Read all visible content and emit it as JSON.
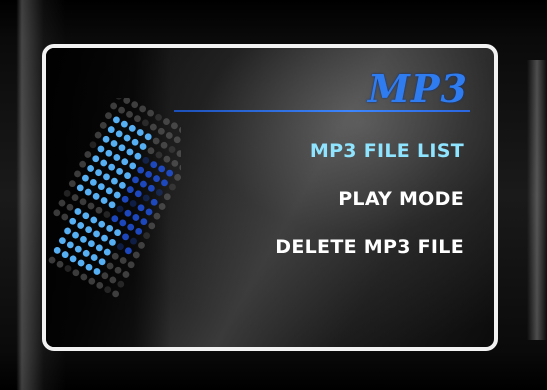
{
  "screen": {
    "title": "MP3"
  },
  "menu": {
    "items": [
      {
        "label": "MP3 FILE LIST",
        "selected": true
      },
      {
        "label": "PLAY MODE",
        "selected": false
      },
      {
        "label": "DELETE MP3 FILE",
        "selected": false
      }
    ]
  },
  "colors": {
    "title": "#2e7cf0",
    "selected_item": "#8fe4ff",
    "item": "#ffffff",
    "border": "#f2f2f2",
    "dot_bright": "#5ab8ff",
    "dot_dim": "#1f4fd0",
    "dot_grey": "#6a6a6a"
  },
  "decoration": {
    "icon": "led-dot-matrix-icon"
  }
}
